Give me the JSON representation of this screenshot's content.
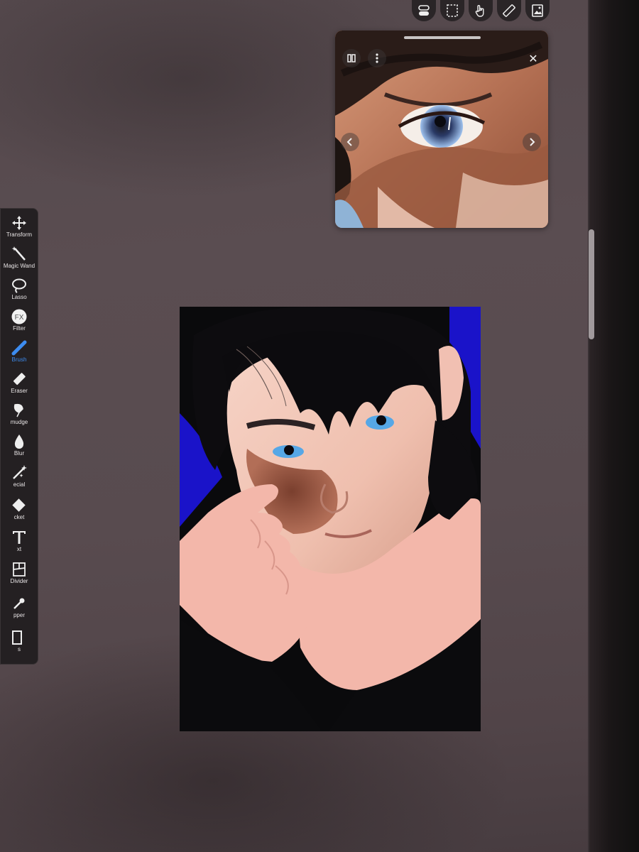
{
  "toolbar": {
    "tools": [
      {
        "icon": "move-arrows-icon",
        "label": "Transform"
      },
      {
        "icon": "magic-wand-icon",
        "label": "Magic Wand"
      },
      {
        "icon": "lasso-icon",
        "label": "Lasso"
      },
      {
        "icon": "fx-icon",
        "label": "Filter"
      },
      {
        "icon": "brush-icon",
        "label": "Brush",
        "active": true
      },
      {
        "icon": "eraser-icon",
        "label": "Eraser"
      },
      {
        "icon": "smudge-icon",
        "label": "mudge"
      },
      {
        "icon": "blur-drop-icon",
        "label": "Blur"
      },
      {
        "icon": "special-wand-icon",
        "label": "ecial"
      },
      {
        "icon": "bucket-icon",
        "label": "cket"
      },
      {
        "icon": "text-icon",
        "label": "xt"
      },
      {
        "icon": "frame-divider-icon",
        "label": "Divider"
      },
      {
        "icon": "eyedropper-icon",
        "label": "pper"
      },
      {
        "icon": "canvas-icon",
        "label": "s"
      }
    ]
  },
  "top_toolbar": {
    "buttons": [
      "layers-toggle-icon",
      "selection-icon",
      "hand-tool-icon",
      "ruler-icon",
      "reference-image-icon"
    ]
  },
  "reference_window": {
    "close_label": "✕"
  },
  "colors": {
    "accent": "#3d8cf0",
    "panel": "#242022",
    "canvas_bg": "#1a13c9",
    "skin": "#f3b7aa"
  }
}
